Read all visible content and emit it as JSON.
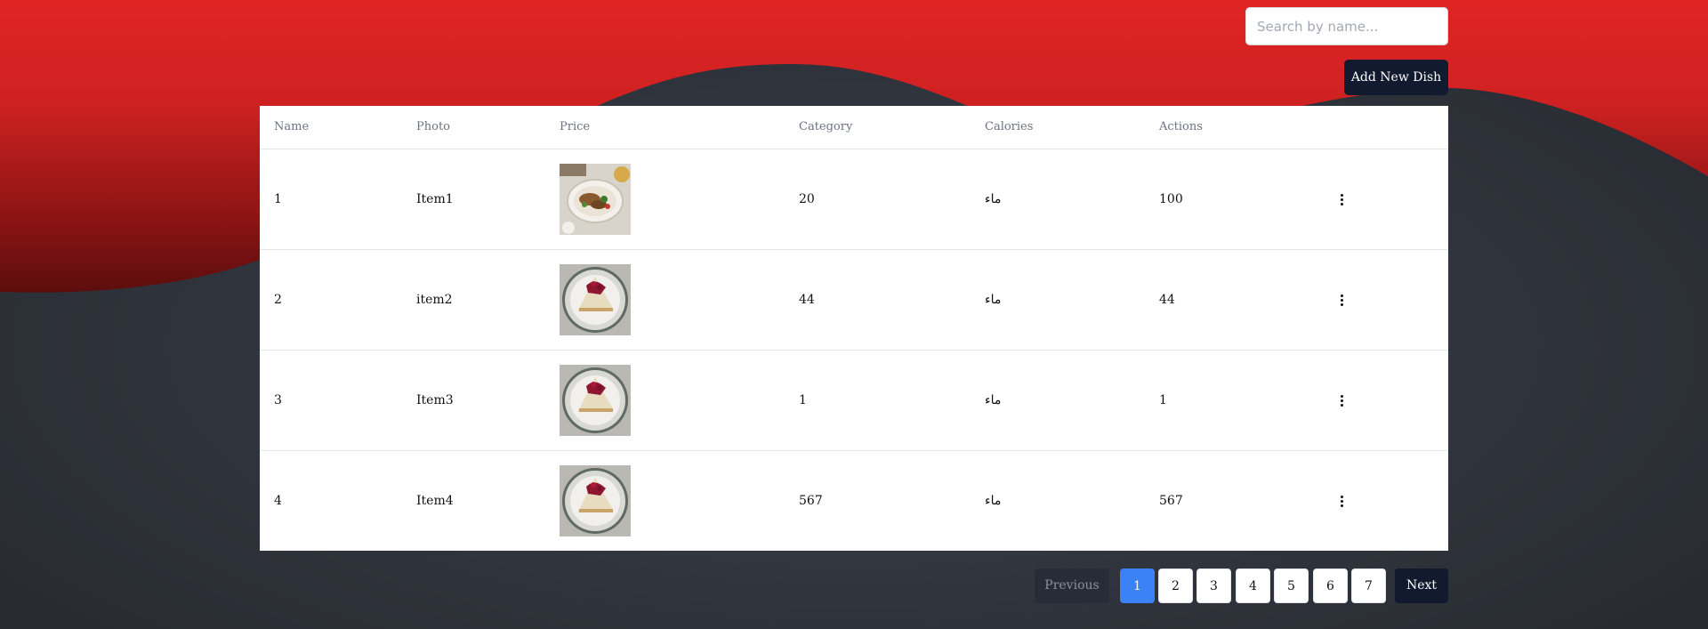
{
  "search": {
    "placeholder": "Search by name..."
  },
  "toolbar": {
    "add_label": "Add New Dish"
  },
  "table": {
    "columns": [
      "Name",
      "Photo",
      "Price",
      "Category",
      "Calories",
      "Actions"
    ],
    "rows": [
      {
        "id": "1",
        "name": "Item1",
        "photo": "food-platter-image",
        "price": "20",
        "category": "ماء",
        "calories": "100"
      },
      {
        "id": "2",
        "name": "item2",
        "photo": "cheesecake-image",
        "price": "44",
        "category": "ماء",
        "calories": "44"
      },
      {
        "id": "3",
        "name": "Item3",
        "photo": "cheesecake-image",
        "price": "1",
        "category": "ماء",
        "calories": "1"
      },
      {
        "id": "4",
        "name": "Item4",
        "photo": "cheesecake-image",
        "price": "567",
        "category": "ماء",
        "calories": "567"
      }
    ],
    "row_menu_icon": "kebab-menu-icon"
  },
  "pagination": {
    "previous_label": "Previous",
    "next_label": "Next",
    "pages": [
      "1",
      "2",
      "3",
      "4",
      "5",
      "6",
      "7"
    ],
    "current": "1"
  },
  "colors": {
    "header_red": "#dc2626",
    "background_dark": "#2f333b",
    "primary_button": "#111a2e",
    "active_page": "#3b82f6"
  }
}
